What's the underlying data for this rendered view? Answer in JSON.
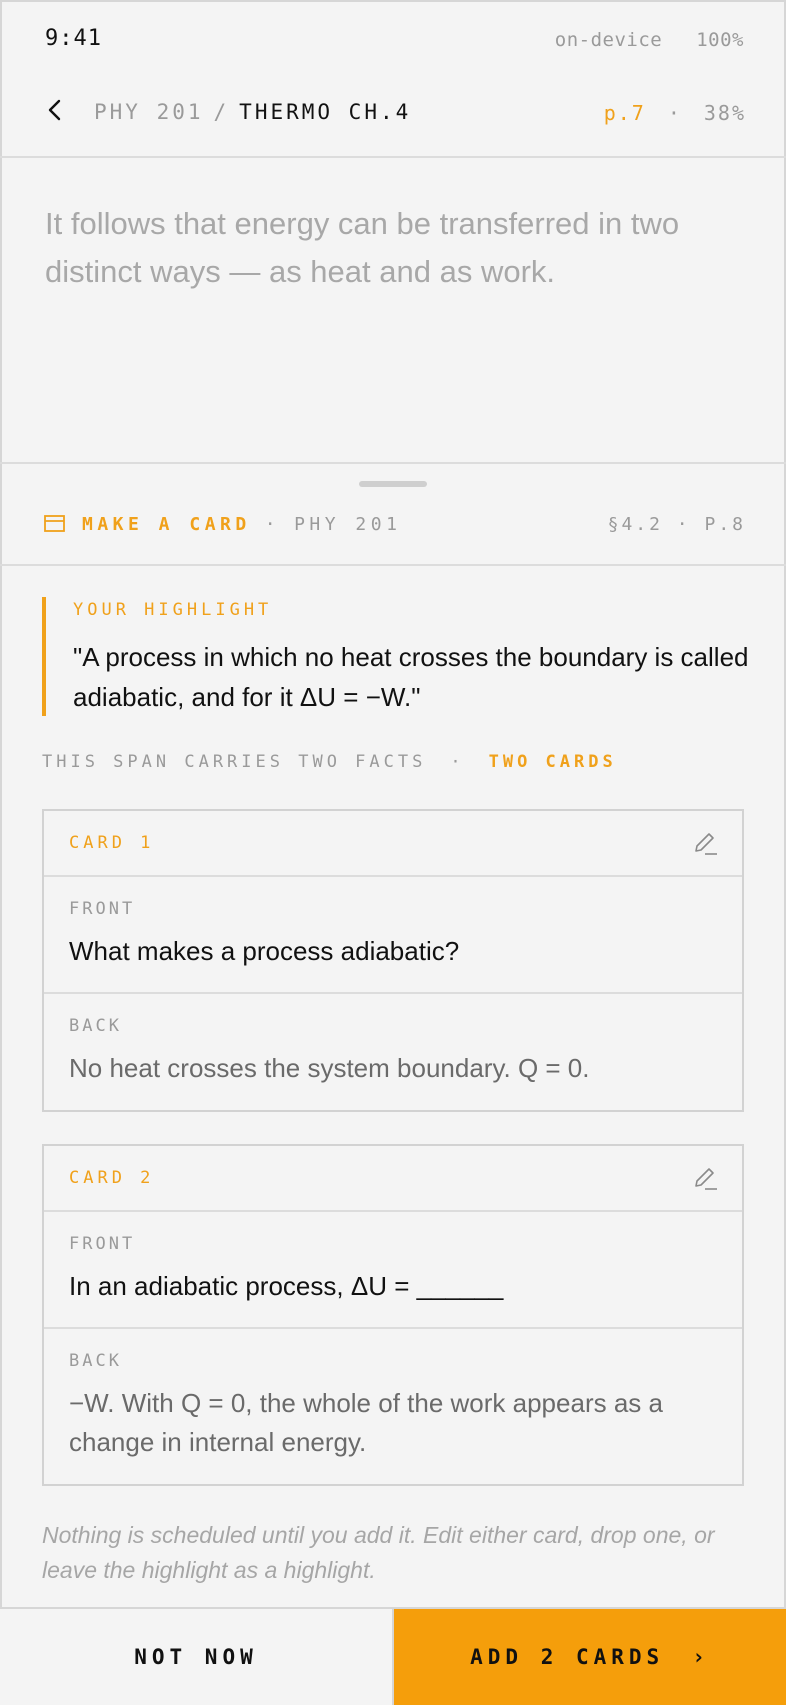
{
  "status": {
    "time": "9:41",
    "mode": "on-device",
    "battery": "100%"
  },
  "nav": {
    "course": "PHY 201",
    "separator": "/",
    "chapter": "THERMO CH.4",
    "page": "p.7",
    "dot": "·",
    "progress": "38%"
  },
  "reading": {
    "text": "It follows that energy can be transferred in two distinct ways — as heat and as work."
  },
  "sheet": {
    "title": "MAKE A CARD",
    "dot": "·",
    "course": "PHY 201",
    "location": "§4.2 · P.8"
  },
  "highlight": {
    "label": "YOUR HIGHLIGHT",
    "quote": "\"A process in which no heat crosses the boundary is called adiabatic, and for it ΔU = −W.\""
  },
  "facts": {
    "text": "THIS SPAN CARRIES TWO FACTS",
    "dot": "·",
    "count": "TWO CARDS"
  },
  "cards": [
    {
      "title": "CARD 1",
      "front_label": "FRONT",
      "front": "What makes a process adiabatic?",
      "back_label": "BACK",
      "back": "No heat crosses the system boundary. Q = 0."
    },
    {
      "title": "CARD 2",
      "front_label": "FRONT",
      "front": "In an adiabatic process, ΔU = ______",
      "back_label": "BACK",
      "back": "−W. With Q = 0, the whole of the work appears as a change in internal energy."
    }
  ],
  "note": "Nothing is scheduled until you add it. Edit either card, drop one, or leave the highlight as a highlight.",
  "footer": {
    "not_now": "NOT NOW",
    "add": "ADD 2 CARDS",
    "add_chevron": "›"
  },
  "colors": {
    "accent": "#f0a11b",
    "button": "#f59e0b",
    "muted": "#9a9a9a",
    "background": "#f4f4f4"
  }
}
